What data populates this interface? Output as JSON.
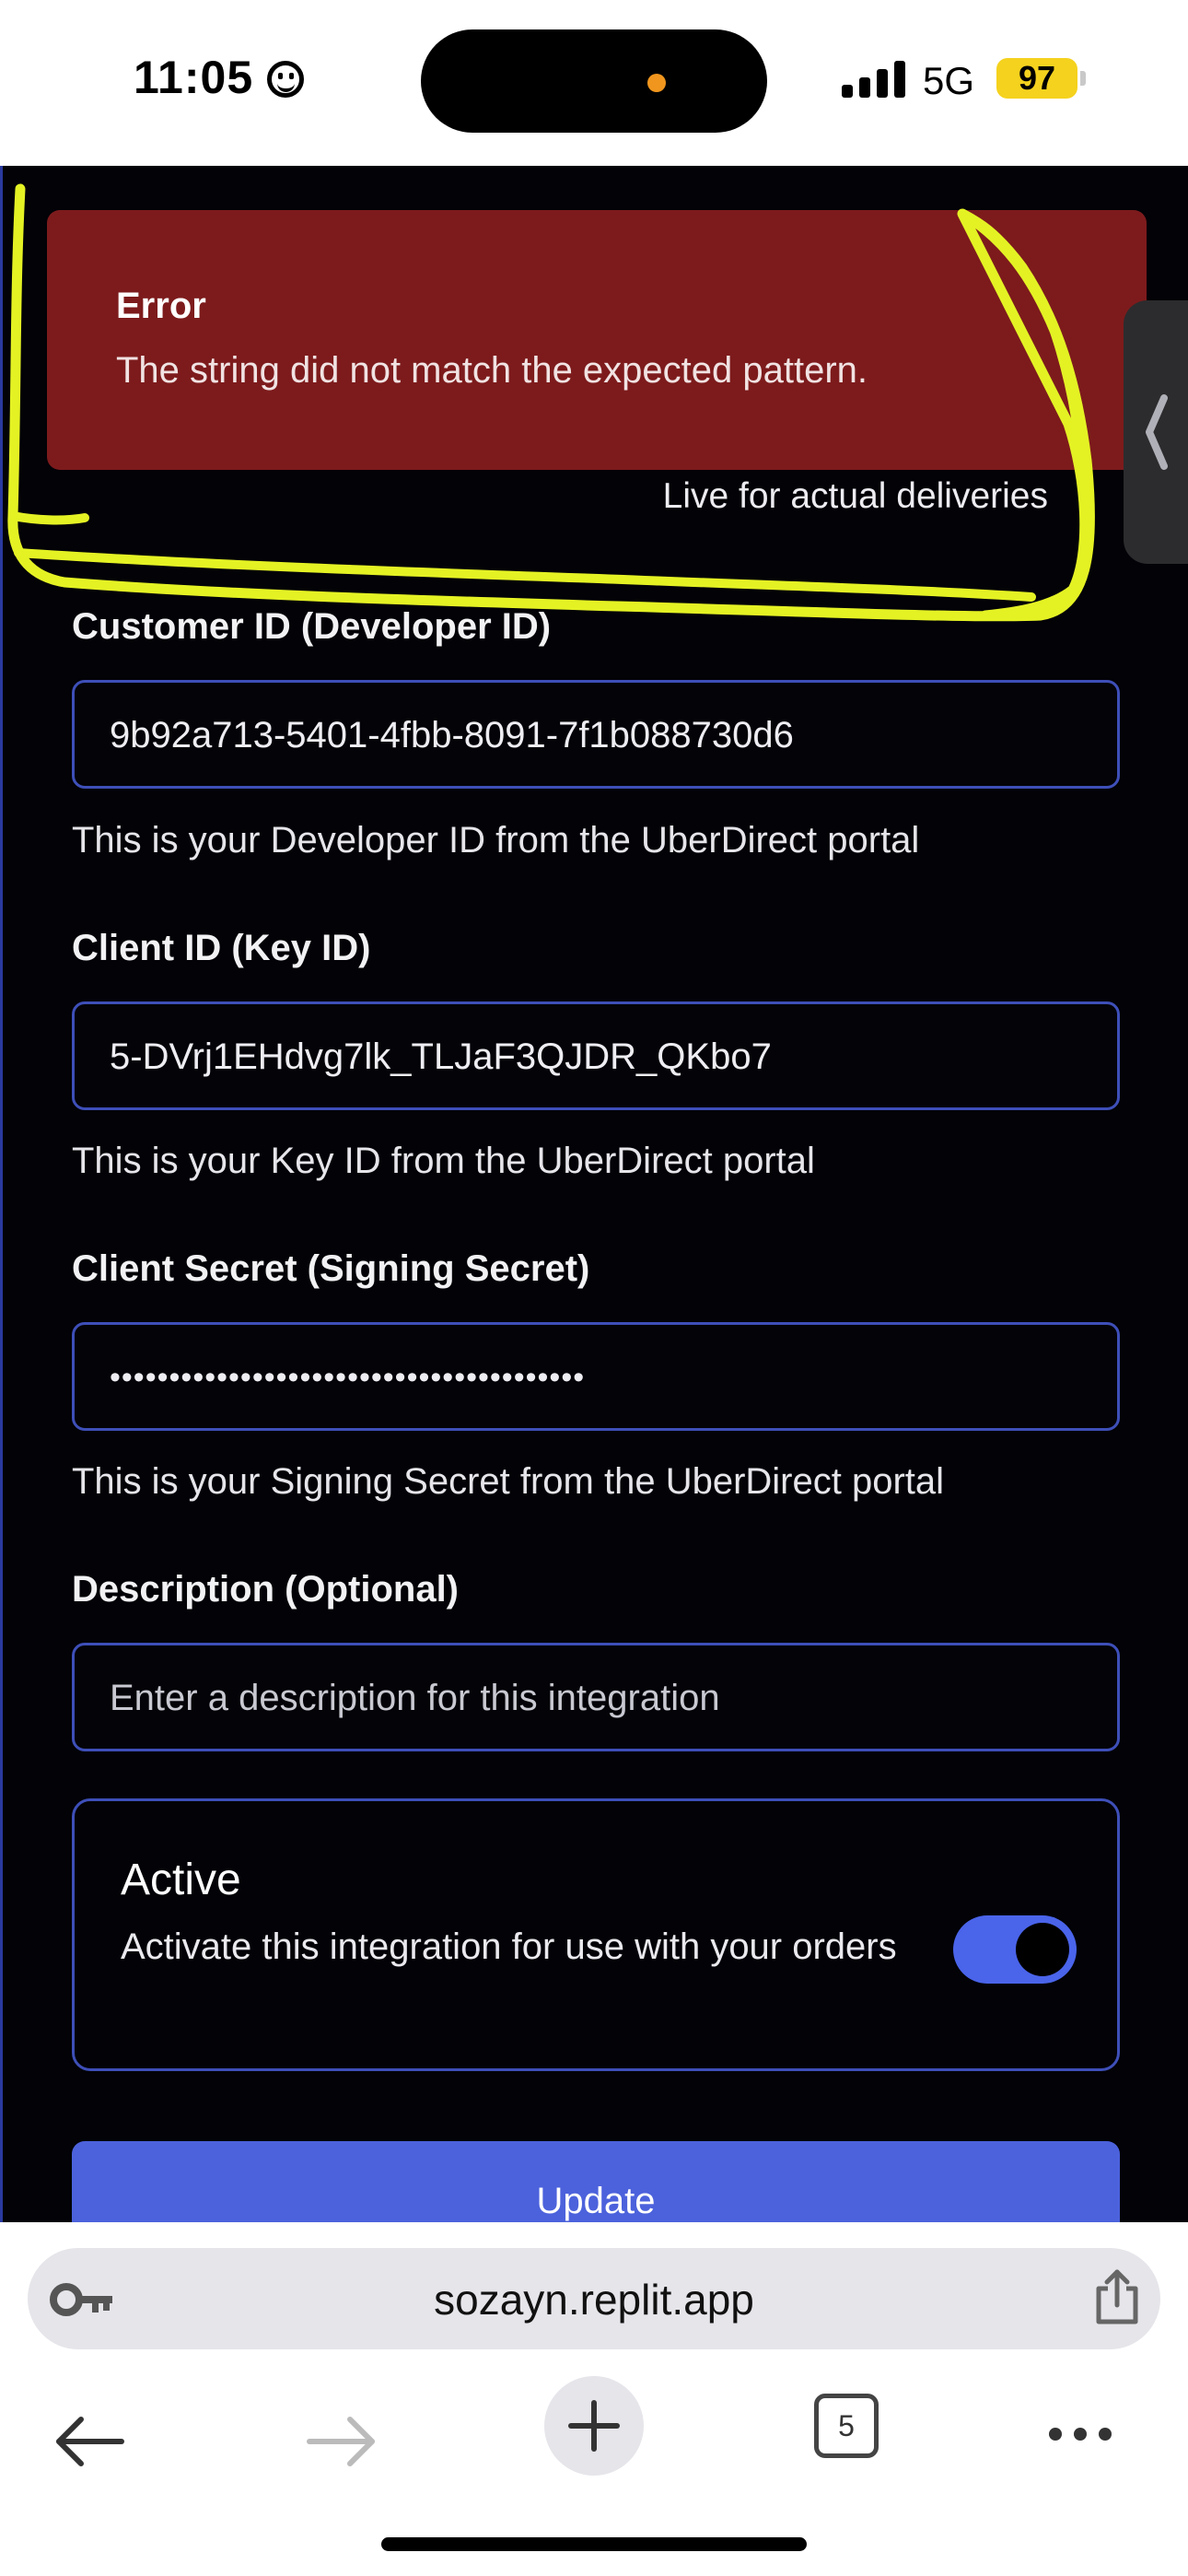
{
  "status_bar": {
    "time": "11:05",
    "network": "5G",
    "battery": "97"
  },
  "alert": {
    "title": "Error",
    "message": "The string did not match the expected pattern."
  },
  "mode_note": "Live for actual deliveries",
  "form": {
    "customer_id": {
      "label": "Customer ID (Developer ID)",
      "value": "9b92a713-5401-4fbb-8091-7f1b088730d6",
      "help": "This is your Developer ID from the UberDirect portal"
    },
    "client_id": {
      "label": "Client ID (Key ID)",
      "value": "5-DVrj1EHdvg7lk_TLJaF3QJDR_QKbo7",
      "help": "This is your Key ID from the UberDirect portal"
    },
    "client_secret": {
      "label": "Client Secret (Signing Secret)",
      "value": "••••••••••••••••••••••••••••••••••••••••",
      "help": "This is your Signing Secret from the UberDirect portal"
    },
    "description": {
      "label": "Description (Optional)",
      "placeholder": "Enter a description for this integration"
    },
    "active": {
      "title": "Active",
      "description": "Activate this integration for use with your orders",
      "enabled": true
    },
    "update_label": "Update"
  },
  "browser": {
    "url": "sozayn.replit.app",
    "tab_count": "5"
  },
  "colors": {
    "error_bg": "#7d1b1c",
    "accent": "#4c62dc",
    "field_border": "#3e4fb8",
    "highlight_scribble": "#e4f224"
  }
}
